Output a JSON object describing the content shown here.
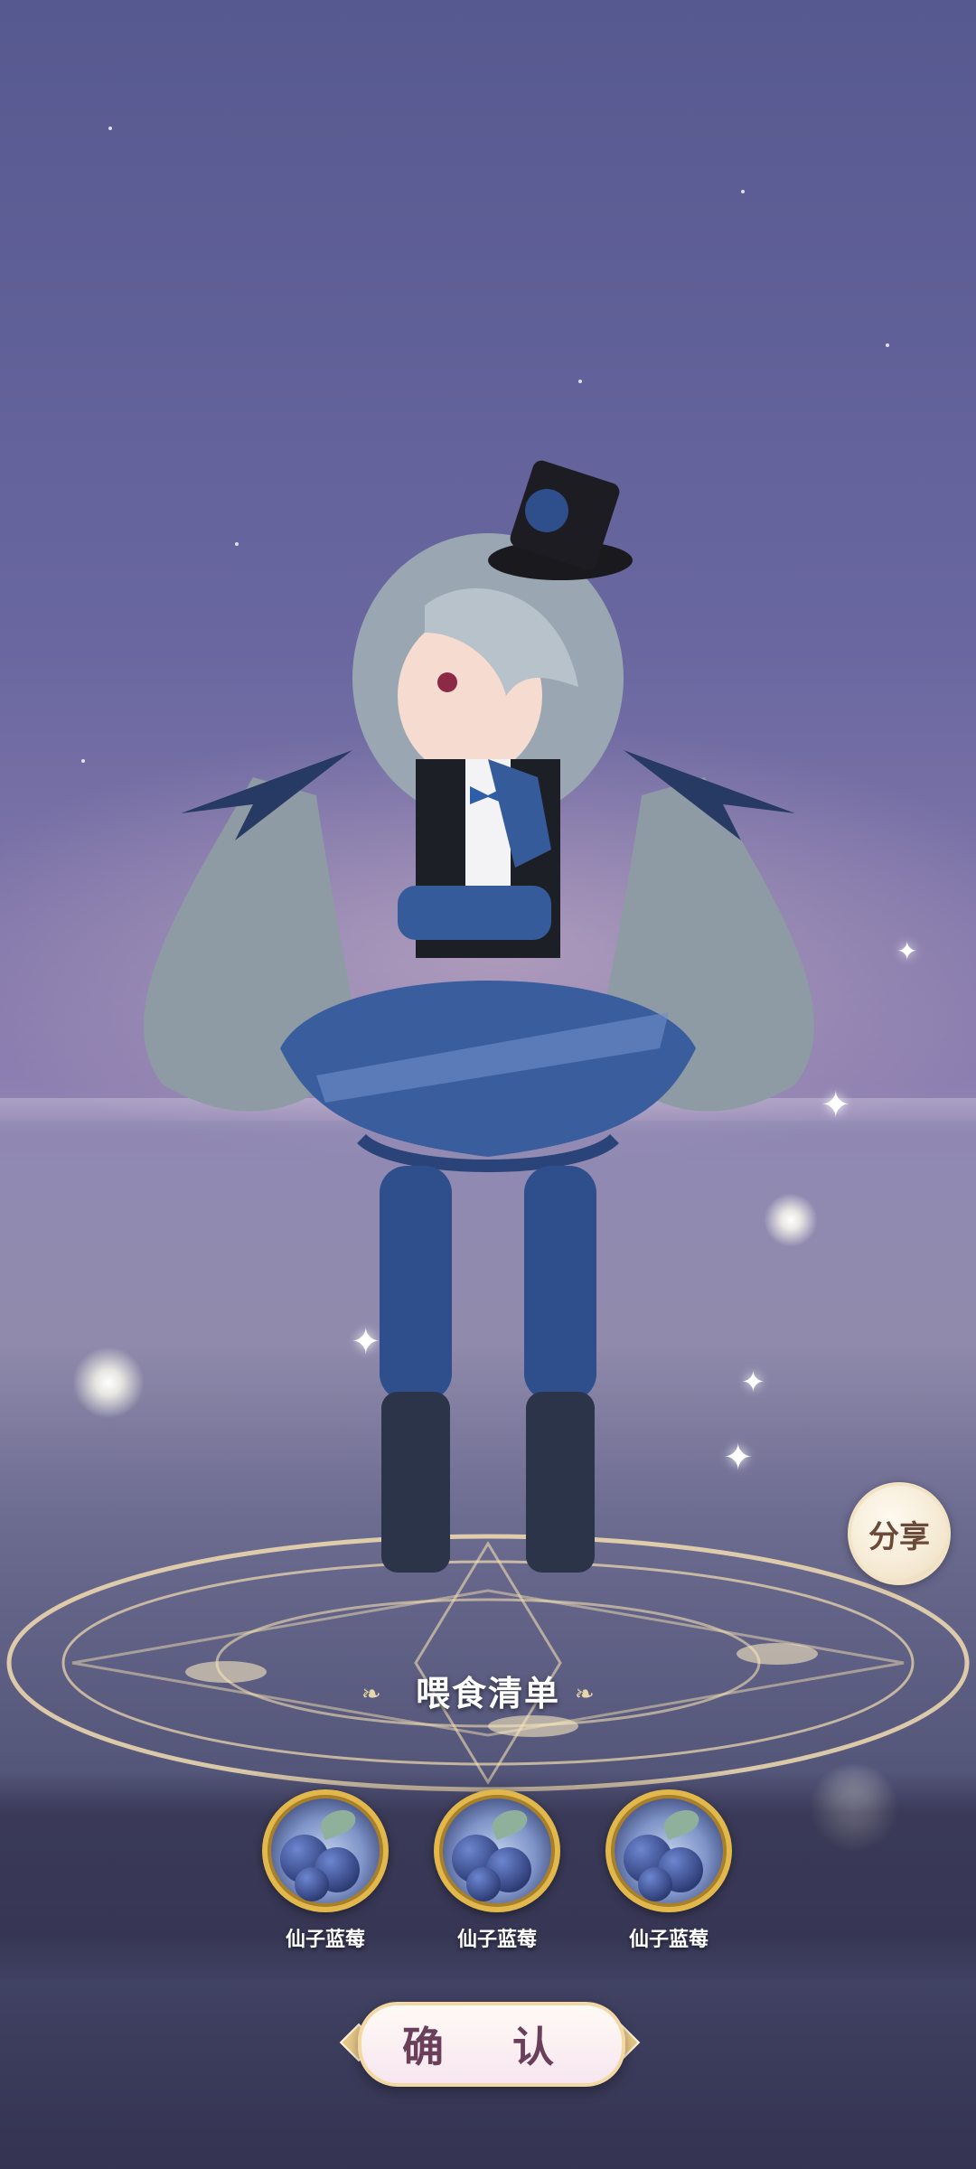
{
  "share_button": {
    "label": "分享"
  },
  "feed_list": {
    "title": "喂食清单",
    "items": [
      {
        "name": "仙子蓝莓"
      },
      {
        "name": "仙子蓝莓"
      },
      {
        "name": "仙子蓝莓"
      }
    ]
  },
  "confirm_button": {
    "label": "确 认"
  },
  "colors": {
    "sky": "#5b5c93",
    "gold_ring": "#e2b84a",
    "button_text": "#6a3f5a"
  },
  "icons": [
    "food-berry-icon",
    "leaf-ornament-icon",
    "magic-circle"
  ]
}
